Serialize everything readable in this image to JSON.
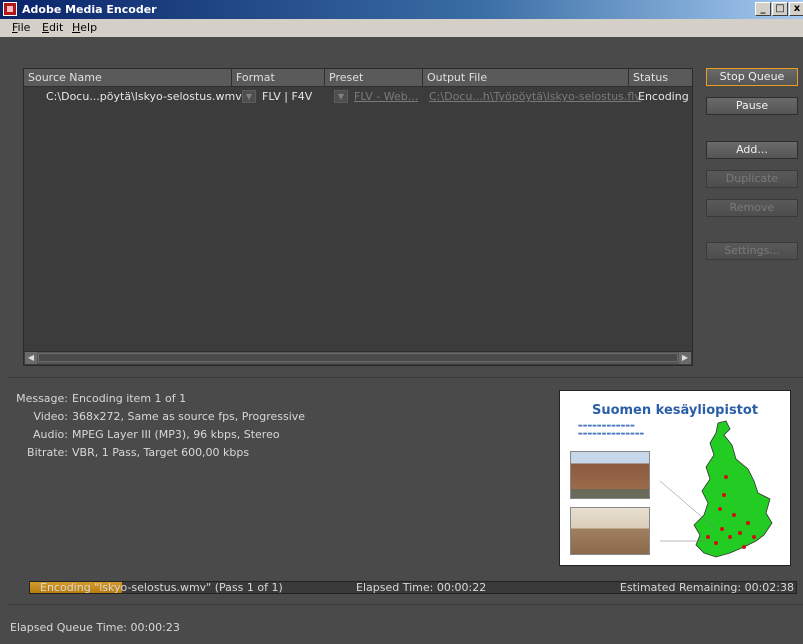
{
  "window": {
    "title": "Adobe Media Encoder",
    "minimize_glyph": "_",
    "maximize_glyph": "□",
    "close_glyph": "x"
  },
  "menu": {
    "items": [
      {
        "label": "File",
        "mnemonic": "F",
        "rest": "ile"
      },
      {
        "label": "Edit",
        "mnemonic": "E",
        "rest": "dit"
      },
      {
        "label": "Help",
        "mnemonic": "H",
        "rest": "elp"
      }
    ]
  },
  "queue": {
    "columns": [
      "Source Name",
      "Format",
      "Preset",
      "Output File",
      "Status"
    ],
    "rows": [
      {
        "source": "C:\\Docu...pöytä\\lskyo-selostus.wmv",
        "format": "FLV | F4V",
        "preset": "FLV - Web...",
        "output": "C:\\Docu...h\\Työpöytä\\lskyo-selostus.flv",
        "status": "Encoding"
      }
    ]
  },
  "buttons": {
    "stop_queue": "Stop Queue",
    "pause": "Pause",
    "add": "Add...",
    "duplicate": "Duplicate",
    "remove": "Remove",
    "settings": "Settings..."
  },
  "info": {
    "message_label": "Message:",
    "message": "Encoding item 1 of 1",
    "video_label": "Video:",
    "video": "368x272, Same as source fps, Progressive",
    "audio_label": "Audio:",
    "audio": "MPEG Layer III (MP3), 96 kbps, Stereo",
    "bitrate_label": "Bitrate:",
    "bitrate": "VBR, 1 Pass, Target 600,00 kbps"
  },
  "preview": {
    "slide_title": "Suomen kesäyliopistot",
    "map_color": "#22cc22"
  },
  "progress": {
    "label": "Encoding \"lskyo-selostus.wmv\" (Pass 1 of 1)",
    "fraction": 0.12,
    "elapsed": "Elapsed Time: 00:00:22",
    "remaining": "Estimated Remaining: 00:02:38"
  },
  "footer": {
    "queue_time": "Elapsed Queue Time: 00:00:23"
  }
}
